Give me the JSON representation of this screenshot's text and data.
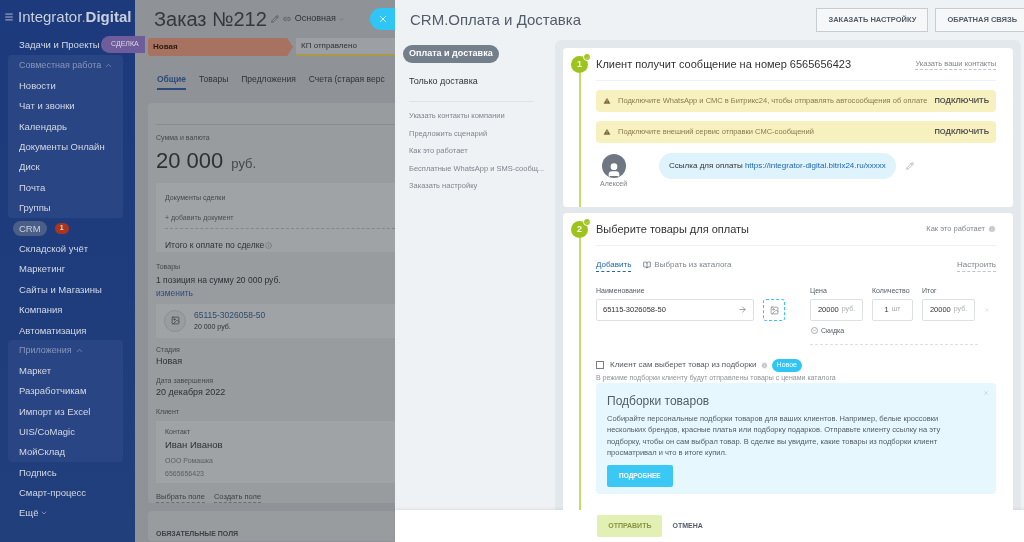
{
  "sidebar": {
    "brand": {
      "light": "Integrator",
      "dot": ".",
      "bold": "Digital"
    },
    "slider_tab": "СДЕЛКА",
    "items": [
      {
        "kind": "link",
        "label": "Задачи и Проекты",
        "selected": false
      },
      {
        "kind": "group",
        "label": "Совместная работа",
        "expanded": true,
        "children": [
          {
            "label": "Новости",
            "selected": false
          },
          {
            "label": "Чат и звонки",
            "selected": false
          },
          {
            "label": "Календарь",
            "selected": false
          },
          {
            "label": "Документы Онлайн",
            "selected": false
          },
          {
            "label": "Диск",
            "selected": false
          },
          {
            "label": "Почта",
            "selected": false
          },
          {
            "label": "Группы",
            "selected": false
          }
        ]
      },
      {
        "kind": "link",
        "label": "CRM",
        "selected": true,
        "counter": "1"
      },
      {
        "kind": "link",
        "label": "Складской учёт",
        "selected": false
      },
      {
        "kind": "link",
        "label": "Маркетинг",
        "selected": false
      },
      {
        "kind": "link",
        "label": "Сайты и Магазины",
        "selected": false
      },
      {
        "kind": "link",
        "label": "Компания",
        "selected": false
      },
      {
        "kind": "link",
        "label": "Автоматизация",
        "selected": false
      },
      {
        "kind": "group",
        "label": "Приложения",
        "expanded": true,
        "children": [
          {
            "label": "Маркет",
            "selected": false
          },
          {
            "label": "Разработчикам",
            "selected": false
          },
          {
            "label": "Импорт из Excel",
            "selected": false
          },
          {
            "label": "UIS/CoMagic",
            "selected": false
          },
          {
            "label": "МойСклад",
            "selected": false
          }
        ]
      },
      {
        "kind": "link",
        "label": "Подпись",
        "selected": false
      },
      {
        "kind": "link",
        "label": "Смарт-процесс",
        "selected": false
      },
      {
        "kind": "more",
        "label": "Ещё",
        "expanded": false
      }
    ]
  },
  "deal": {
    "title": "Заказ №212",
    "category": "Основная",
    "stages": [
      {
        "label": "Новая",
        "selected": true
      },
      {
        "label": "КП отправлено",
        "selected": false
      }
    ],
    "tabs": [
      {
        "label": "Общие",
        "selected": true
      },
      {
        "label": "Товары",
        "selected": false
      },
      {
        "label": "Предложения",
        "selected": false
      },
      {
        "label": "Счета (старая верс",
        "selected": false
      }
    ],
    "sum": {
      "label": "Сумма и валюта",
      "amount": "20 000",
      "currency": "руб."
    },
    "documents": {
      "label": "Документы сделки",
      "add": "+ добавить документ",
      "total": "Итого к оплате по сделке"
    },
    "products": {
      "label": "Товары",
      "summary": "1 позиция на сумму 20 000 руб.",
      "edit": "изменить",
      "items": [
        {
          "name": "65115-3026058-50",
          "price": "20 000 руб."
        }
      ]
    },
    "fields": [
      {
        "label": "Стадия",
        "value": "Новая"
      },
      {
        "label": "Дата завершения",
        "value": "20 декабря 2022"
      }
    ],
    "client": {
      "label": "Клиент",
      "contact_label": "Контакт",
      "name": "Иван Иванов",
      "company": "ООО Ромашка",
      "phone": "6565656423"
    },
    "field_links": [
      "Выбрать поле",
      "Создать поле"
    ],
    "next_section": "ОБЯЗАТЕЛЬНЫЕ ПОЛЯ"
  },
  "slider": {
    "title": "CRM.Оплата и Доставка",
    "buttons": [
      "ЗАКАЗАТЬ НАСТРОЙКУ",
      "ОБРАТНАЯ СВЯЗЬ"
    ],
    "modes": [
      {
        "label": "Оплата и доставка",
        "selected": true
      },
      {
        "label": "Только доставка",
        "selected": false
      }
    ],
    "links": [
      "Указать контакты компании",
      "Предложить сценарий",
      "Как это работает",
      "Бесплатные WhatsApp и SMS-сообщ...",
      "Заказать настройку"
    ],
    "step1": {
      "number": "1",
      "done": true,
      "title": "Клиент получит сообщение на номер 6565656423",
      "link": "Указать ваши контакты",
      "alerts": [
        {
          "text": "Подключите WhatsApp и СМС в Битрикс24, чтобы отправлять автосообщения об оплате",
          "action": "ПОДКЛЮЧИТЬ"
        },
        {
          "text": "Подключите внешний сервис отправки СМС-сообщений",
          "action": "ПОДКЛЮЧИТЬ"
        }
      ],
      "message": {
        "author": "Алексей",
        "label": "Ссылка для оплаты",
        "url": "https://integrator-digital.bitrix24.ru/xxxxx"
      }
    },
    "step2": {
      "number": "2",
      "done": true,
      "title": "Выберите товары для оплаты",
      "help": "Как это работает",
      "toolbar": {
        "add": "Добавить",
        "catalog": "Выбрать из каталога",
        "settings": "Настроить"
      },
      "columns": [
        "Наименование",
        "Цена",
        "Количество",
        "Итог"
      ],
      "row": {
        "name": "65115-3026058-50",
        "price": "20000",
        "price_unit": "руб.",
        "quantity": "1",
        "quantity_unit": "шт",
        "total": "20000",
        "total_unit": "руб."
      },
      "discount": "Скидка",
      "selection": {
        "label": "Клиент сам выберет товар из подборки",
        "checked": false,
        "badge": "Новое",
        "hint": "В режиме подборки клиенту будут отправлены товары с ценами каталога"
      },
      "info": {
        "title": "Подборки товаров",
        "text": "Собирайте персональные подборки товаров для ваших клиентов. Например, белые кроссовки нескольких брендов, красные платья или подборку подарков. Отправьте клиенту ссылку на эту подборку, чтобы он сам выбрал товар. В сделке вы увидите, какие товары из подборки клиент просматривал и что в итоге купил.",
        "button": "ПОДРОБНЕЕ"
      }
    },
    "footer": {
      "submit": {
        "label": "ОТПРАВИТЬ",
        "disabled": true
      },
      "cancel": "ОТМЕНА"
    }
  }
}
